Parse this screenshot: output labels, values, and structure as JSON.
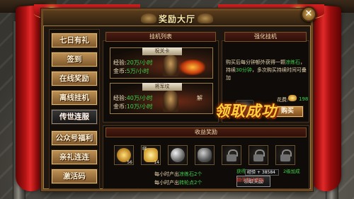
{
  "window": {
    "title": "奖励大厅",
    "close_label": "✕"
  },
  "sidebar": {
    "items": [
      {
        "label": "七日有礼",
        "active": false
      },
      {
        "label": "签到",
        "active": false
      },
      {
        "label": "在线奖励",
        "active": false
      },
      {
        "label": "离线挂机",
        "active": false
      },
      {
        "label": "传世连服",
        "active": true
      },
      {
        "label": "公众号福利",
        "active": false
      },
      {
        "label": "亲礼连连",
        "active": false
      },
      {
        "label": "激活码",
        "active": false
      }
    ]
  },
  "afk_list": {
    "header": "挂机列表",
    "entries": [
      {
        "name": "祝关卡",
        "exp_label": "经验:",
        "exp_value": "20万/小时",
        "gold_label": "金币:",
        "gold_value": "5万/小时"
      },
      {
        "name": "将军坟",
        "exp_label": "经验:",
        "exp_value": "40万/小时",
        "gold_label": "金币:",
        "gold_value": "10万/小时",
        "tag": "解"
      }
    ]
  },
  "strengthen": {
    "header": "强化挂机",
    "desc_prefix": "购买后每分钟额外获得一颗",
    "desc_item": "凉练石",
    "desc_mid": "，持续",
    "desc_duration": "30分钟",
    "desc_suffix": "，多次购买持续时间可叠加",
    "cost_label": "花费:",
    "cost_value": "198",
    "buy_label": "购买"
  },
  "overlay": {
    "success_text": "领取成功"
  },
  "rewards": {
    "header": "收益奖励",
    "items": [
      {
        "icon": "coin-icon",
        "count": "56"
      },
      {
        "icon": "gold-ingot-icon",
        "count": "14",
        "tag": "绑"
      },
      {
        "icon": "pearl-icon",
        "count": ""
      },
      {
        "icon": "stone-icon",
        "count": ""
      },
      {
        "icon": "lock-icon",
        "count": ""
      },
      {
        "icon": "lock-icon",
        "count": ""
      },
      {
        "icon": "lock-icon",
        "count": ""
      }
    ],
    "hourly": [
      {
        "prefix": "每小时产出",
        "item": "凉练石2个"
      },
      {
        "prefix": "每小时产出",
        "item": "转轮点2个"
      }
    ],
    "claim_label": "领取奖励"
  },
  "status": {
    "exp_label": "经验",
    "exp_value": "+ 38584",
    "row1_left": "获得",
    "row1_right": "2级加成",
    "row2": "翻倍在线奖励"
  },
  "colors": {
    "accent_gold": "#ffd13a",
    "green_value": "#40d14a",
    "curtain_red": "#b41313"
  }
}
